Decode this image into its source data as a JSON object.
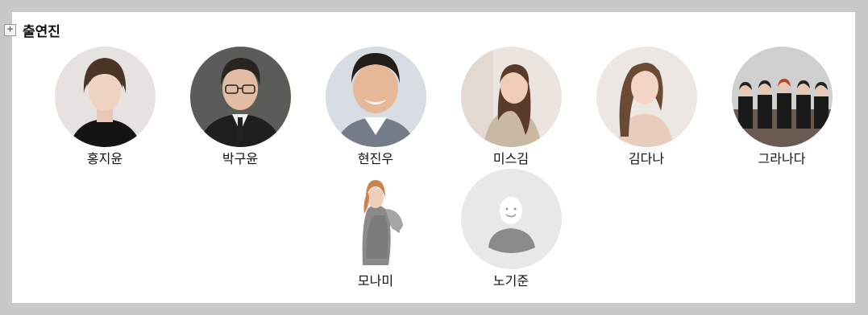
{
  "section": {
    "toggle_symbol": "+",
    "title": "출연진"
  },
  "cast": [
    {
      "name": "홍지윤",
      "photo": "woman-black-turtleneck-photo"
    },
    {
      "name": "박구윤",
      "photo": "man-glasses-suit-photo"
    },
    {
      "name": "현진우",
      "photo": "man-smiling-suit-photo"
    },
    {
      "name": "미스김",
      "photo": "woman-beige-outfit-photo"
    },
    {
      "name": "김다나",
      "photo": "woman-long-hair-photo"
    },
    {
      "name": "그라나다",
      "photo": "group-five-women-photo"
    },
    {
      "name": "모나미",
      "photo": "woman-silver-dress-photo"
    },
    {
      "name": "노기준",
      "photo": "default-profile-placeholder"
    }
  ]
}
